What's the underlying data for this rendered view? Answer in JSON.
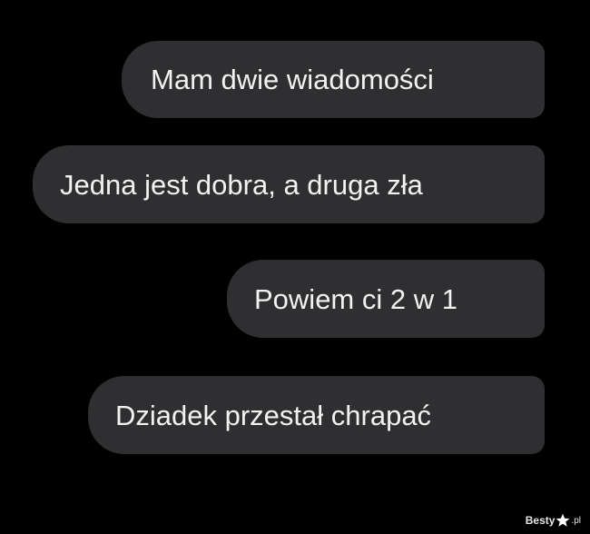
{
  "messages": [
    {
      "text": "Mam dwie wiadomości"
    },
    {
      "text": "Jedna jest dobra, a druga zła"
    },
    {
      "text": "Powiem ci 2 w 1"
    },
    {
      "text": "Dziadek przestał chrapać"
    }
  ],
  "watermark": {
    "brand": "Besty",
    "tld": ".pl",
    "icon": "star-icon"
  },
  "colors": {
    "background": "#000000",
    "bubble": "#2f2f31",
    "text": "#f2f2f2"
  }
}
